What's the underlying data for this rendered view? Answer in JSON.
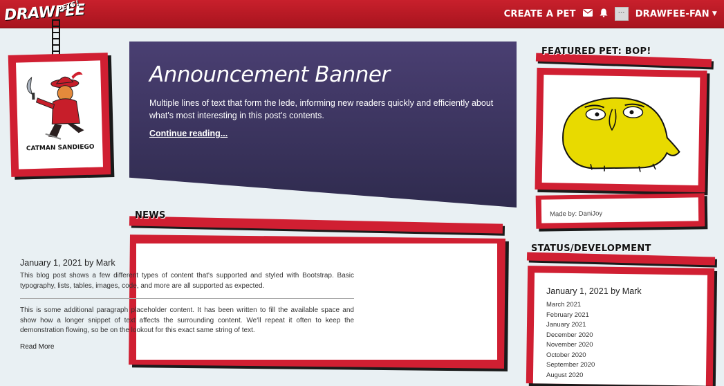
{
  "navbar": {
    "logo": "DRAWFEE",
    "logo_badge": "PETS!",
    "create_label": "CREATE A PET",
    "username": "DRAWFEE-FAN",
    "icons": [
      "envelope-icon",
      "bell-icon",
      "user-avatar",
      "caret-down-icon"
    ]
  },
  "pet_card": {
    "name": "CATMAN SANDIEGO"
  },
  "banner": {
    "title": "Announcement Banner",
    "lede": "Multiple lines of text that form the lede, informing new readers quickly and efficiently about what's most interesting in this post's contents.",
    "link": "Continue reading..."
  },
  "news": {
    "heading": "NEWS",
    "post_title": "January 1, 2021 by Mark",
    "para1": "This blog post shows a few different types of content that's supported and styled with Bootstrap. Basic typography, lists, tables, images, code, and more are all supported as expected.",
    "para2": "This is some additional paragraph placeholder content. It has been written to fill the available space and show how a longer snippet of text affects the surrounding content. We'll repeat it often to keep the demonstration flowing, so be on the lookout for this exact same string of text.",
    "read_more": "Read More"
  },
  "featured": {
    "heading": "FEATURED PET: BOP!",
    "made_by": "Made by: DaniJoy"
  },
  "status": {
    "heading": "STATUS/DEVELOPMENT",
    "post_title": "January 1, 2021 by Mark",
    "archive": [
      "March 2021",
      "February 2021",
      "January 2021",
      "December 2020",
      "November 2020",
      "October 2020",
      "September 2020",
      "August 2020"
    ]
  },
  "colors": {
    "brand_red": "#d01f32",
    "banner_purple": "#3f3762",
    "background": "#e9f0f3"
  }
}
